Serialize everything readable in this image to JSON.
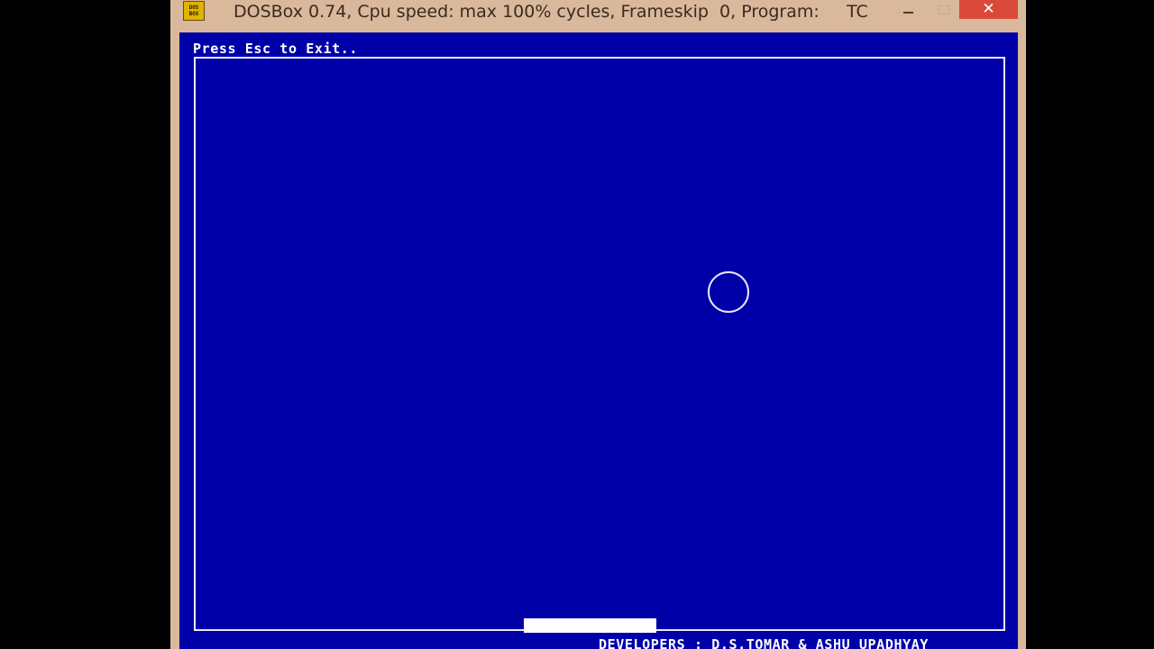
{
  "window": {
    "icon_label": "DOS BOX",
    "title": "DOSBox 0.74, Cpu speed: max 100% cycles, Frameskip  0, Program:     TC",
    "close_symbol": "✕"
  },
  "game": {
    "exit_hint": "Press Esc to Exit..",
    "credits": "DEVELOPERS : D.S.TOMAR & ASHU UPADHYAY"
  },
  "colors": {
    "screen_background": "#0000a8",
    "foreground": "#ffffff",
    "window_frame": "#d9b89b",
    "close_button": "#d94a3b"
  }
}
